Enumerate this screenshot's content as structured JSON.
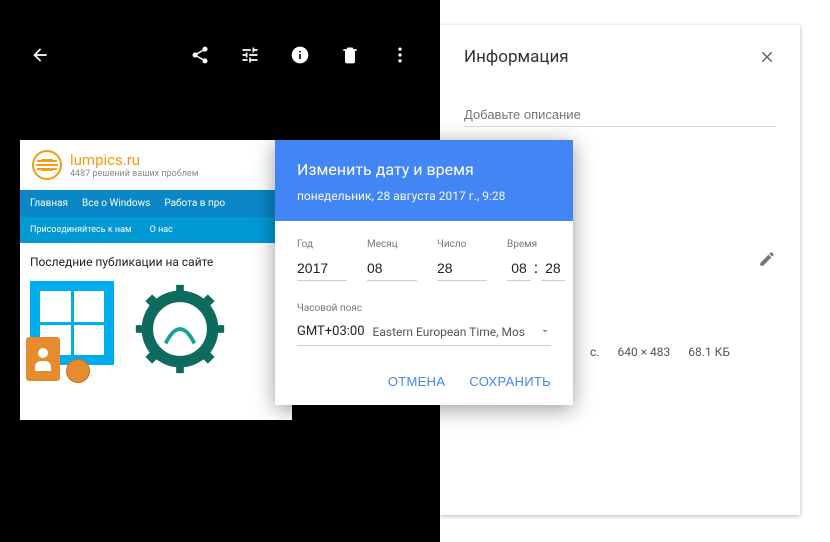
{
  "info_panel": {
    "title": "Информация",
    "description_placeholder": "Добавьте описание",
    "dimensions_suffix": "с.",
    "dimensions": "640 × 483",
    "filesize": "68.1 КБ"
  },
  "dialog": {
    "title": "Изменить дату и время",
    "subtitle": "понедельник, 28 августа 2017 г., 9:28",
    "labels": {
      "year": "Год",
      "month": "Месяц",
      "day": "Число",
      "time": "Время",
      "timezone": "Часовой пояс"
    },
    "values": {
      "year": "2017",
      "month": "08",
      "day": "28",
      "hour": "08",
      "minute": "28"
    },
    "timezone": {
      "offset": "GMT+03:00",
      "name": "Eastern European Time, Mos"
    },
    "buttons": {
      "cancel": "ОТМЕНА",
      "save": "СОХРАНИТЬ"
    }
  },
  "photo_preview": {
    "site_name": "lumpics.ru",
    "site_sub": "4487 решений ваших проблем",
    "nav1": [
      "Главная",
      "Все о Windows",
      "Работа в про"
    ],
    "nav2": [
      "Присоединяйтесь к нам",
      "О нас"
    ],
    "pub_title": "Последние публикации на сайте"
  }
}
